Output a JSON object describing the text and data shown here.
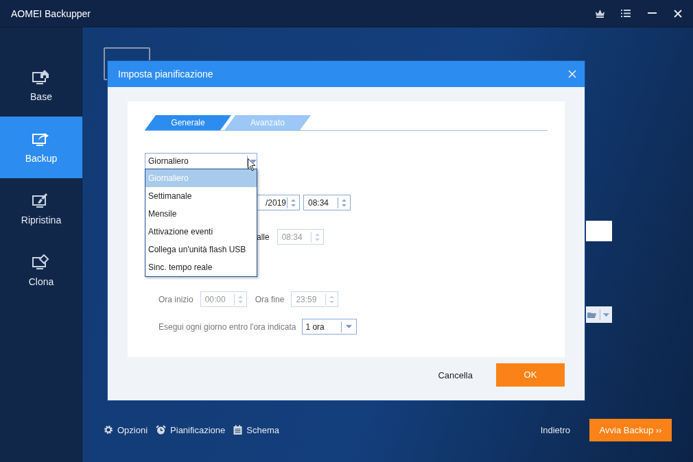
{
  "window": {
    "title": "AOMEI Backupper"
  },
  "sidebar": {
    "items": [
      {
        "label": "Base",
        "kind": "home",
        "selected": false
      },
      {
        "label": "Backup",
        "kind": "backup",
        "selected": true
      },
      {
        "label": "Ripristina",
        "kind": "restore",
        "selected": false
      },
      {
        "label": "Clona",
        "kind": "clone",
        "selected": false
      }
    ]
  },
  "dialog": {
    "title": "Imposta pianificazione",
    "tabs": [
      {
        "label": "Generale",
        "selected": true
      },
      {
        "label": "Avanzato",
        "selected": false
      }
    ],
    "frequency": {
      "value": "Giornaliero",
      "expanded": true,
      "options": [
        {
          "label": "Giornaliero",
          "selected": true
        },
        {
          "label": "Settimanale",
          "selected": false
        },
        {
          "label": "Mensile",
          "selected": false
        },
        {
          "label": "Attivazione eventi",
          "selected": false
        },
        {
          "label": "Collega un'unità flash USB",
          "selected": false
        },
        {
          "label": "Sinc. tempo reale",
          "selected": false
        }
      ]
    },
    "start": {
      "date": "/2019",
      "time": "08:34"
    },
    "repeat": {
      "label": "alle",
      "time": "08:34",
      "disabled": true
    },
    "range": {
      "start_label": "Ora inizio",
      "start": "00:00",
      "end_label": "Ora fine",
      "end": "23:59",
      "disabled": true
    },
    "run_within": {
      "label": "Esegui ogni giorno entro l'ora indicata",
      "value": "1 ora"
    },
    "buttons": {
      "cancel": "Cancella",
      "ok": "OK"
    }
  },
  "footer": {
    "tools": [
      {
        "label": "Opzioni",
        "kind": "gear"
      },
      {
        "label": "Pianificazione",
        "kind": "alarm"
      },
      {
        "label": "Schema",
        "kind": "calendar"
      }
    ],
    "back": "Indietro",
    "start": "Avvia Backup ››"
  }
}
